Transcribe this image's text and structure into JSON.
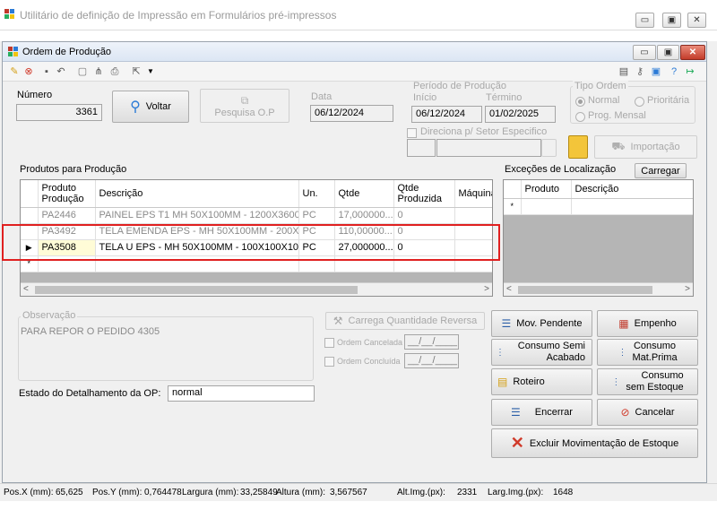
{
  "app": {
    "title": "Utilitário de definição de Impressão em Formulários pré-impressos",
    "window_buttons": {
      "minimize": "▭",
      "restore": "▣",
      "close": "✕"
    }
  },
  "form": {
    "title": "Ordem de Produção",
    "numero_label": "Número",
    "numero_value": "3361",
    "voltar_label": "Voltar",
    "pesquisa_label": "Pesquisa O.P",
    "data_label": "Data",
    "data_value": "06/12/2024",
    "periodo_label": "Período de Produção",
    "inicio_label": "Início",
    "inicio_value": "06/12/2024",
    "termino_label": "Término",
    "termino_value": "01/02/2025",
    "tipo_label": "Tipo Ordem",
    "tipo_normal": "Normal",
    "tipo_prioritaria": "Prioritária",
    "tipo_prog": "Prog. Mensal",
    "direciona_label": "Direciona p/ Setor Especifico",
    "importacao_label": "Importação"
  },
  "produtos": {
    "title": "Produtos para Produção",
    "columns": [
      "Produto Produção",
      "Descrição",
      "Un.",
      "Qtde",
      "Qtde Produzida",
      "Máquina Op."
    ],
    "rows": [
      [
        "PA2446",
        "PAINEL EPS T1 MH 50X100MM - 1200X3600...",
        "PC",
        "17,000000...",
        "0",
        ""
      ],
      [
        "PA3492",
        "TELA EMENDA EPS - MH 50X100MM - 200X...",
        "PC",
        "110,00000...",
        "0",
        ""
      ],
      [
        "PA3508",
        "TELA U EPS - MH 50X100MM - 100X100X10...",
        "PC",
        "27,000000...",
        "0",
        ""
      ]
    ],
    "row_markers": [
      "",
      "",
      "▶"
    ],
    "new_row_marker": "*"
  },
  "excecoes": {
    "title": "Exceções de Localização",
    "carregar_label": "Carregar",
    "columns": [
      "Produto",
      "Descrição"
    ],
    "new_row_marker": "*"
  },
  "observacao": {
    "label": "Observação",
    "value": "PARA REPOR O PEDIDO 4305"
  },
  "carrega_label": "Carrega Quantidade Reversa",
  "ordem_cancelada_label": "Ordem Cancelada",
  "ordem_concluida_label": "Ordem Concluída",
  "date_placeholder": "__/__/____",
  "estado_label": "Estado do Detalhamento da OP:",
  "estado_value": "normal",
  "actions": {
    "mov_pendente": "Mov. Pendente",
    "empenho": "Empenho",
    "consumo_semi_1": "Consumo Semi",
    "consumo_semi_2": "Acabado",
    "consumo_mat_1": "Consumo",
    "consumo_mat_2": "Mat.Prima",
    "roteiro": "Roteiro",
    "consumo_sem_1": "Consumo",
    "consumo_sem_2": "sem Estoque",
    "encerrar": "Encerrar",
    "cancelar": "Cancelar",
    "excluir": "Excluir Movimentação de Estoque"
  },
  "status": {
    "posx_label": "Pos.X (mm):",
    "posx_value": "65,625",
    "posy_label": "Pos.Y (mm):",
    "posy_value": "0,764478",
    "largura_label": "Largura (mm):",
    "largura_value": "33,25849",
    "altura_label": "Altura (mm):",
    "altura_value": "3,567567",
    "altimg_label": "Alt.Img.(px):",
    "altimg_value": "2331",
    "largimg_label": "Larg.Img.(px):",
    "largimg_value": "1648"
  }
}
